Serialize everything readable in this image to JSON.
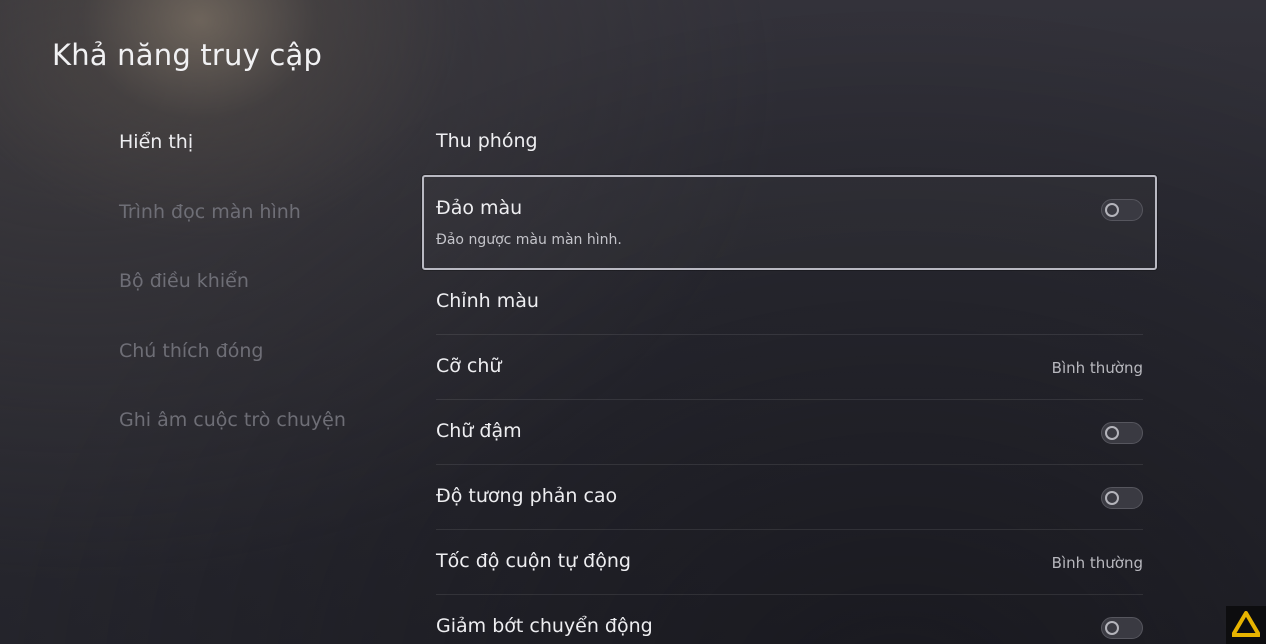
{
  "page": {
    "title": "Khả năng truy cập"
  },
  "nav": {
    "items": [
      {
        "label": "Hiển thị",
        "active": true
      },
      {
        "label": "Trình đọc màn hình",
        "active": false
      },
      {
        "label": "Bộ điều khiển",
        "active": false
      },
      {
        "label": "Chú thích đóng",
        "active": false
      },
      {
        "label": "Ghi âm cuộc trò chuyện",
        "active": false
      }
    ]
  },
  "settings": {
    "zoom": {
      "label": "Thu phóng"
    },
    "invert_colors": {
      "label": "Đảo màu",
      "description": "Đảo ngược màu màn hình.",
      "enabled": false
    },
    "color_correction": {
      "label": "Chỉnh màu"
    },
    "text_size": {
      "label": "Cỡ chữ",
      "value": "Bình thường"
    },
    "bold_text": {
      "label": "Chữ đậm",
      "enabled": false
    },
    "high_contrast": {
      "label": "Độ tương phản cao",
      "enabled": false
    },
    "auto_scroll_speed": {
      "label": "Tốc độ cuộn tự động",
      "value": "Bình thường"
    },
    "reduce_motion": {
      "label": "Giảm bớt chuyển động",
      "enabled": false
    }
  },
  "colors": {
    "focus_border": "#b9b9c2",
    "active_text": "#eeeef1",
    "inactive_text": "#6e6e76",
    "watermark_accent": "#e8b400"
  }
}
